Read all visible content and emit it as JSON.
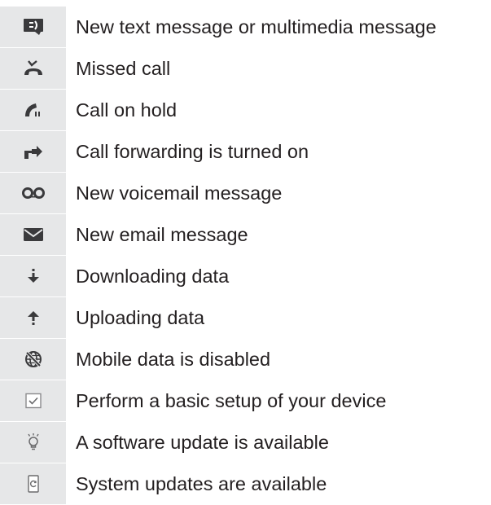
{
  "colors": {
    "icon_background": "#e6e7e8",
    "icon_dark": "#3a3a3c",
    "icon_light": "#8a8a8c",
    "text": "#231f20"
  },
  "items": [
    {
      "icon": "text-message-icon",
      "label": "New text message or multimedia message"
    },
    {
      "icon": "missed-call-icon",
      "label": "Missed call"
    },
    {
      "icon": "call-on-hold-icon",
      "label": "Call on hold"
    },
    {
      "icon": "call-forwarding-icon",
      "label": "Call forwarding is turned on"
    },
    {
      "icon": "voicemail-icon",
      "label": "New voicemail message"
    },
    {
      "icon": "email-icon",
      "label": "New email message"
    },
    {
      "icon": "download-icon",
      "label": "Downloading data"
    },
    {
      "icon": "upload-icon",
      "label": "Uploading data"
    },
    {
      "icon": "mobile-data-disabled-icon",
      "label": "Mobile data is disabled"
    },
    {
      "icon": "setup-checkbox-icon",
      "label": "Perform a basic setup of your device"
    },
    {
      "icon": "software-update-icon",
      "label": "A software update is available"
    },
    {
      "icon": "system-update-icon",
      "label": "System updates are available"
    }
  ]
}
